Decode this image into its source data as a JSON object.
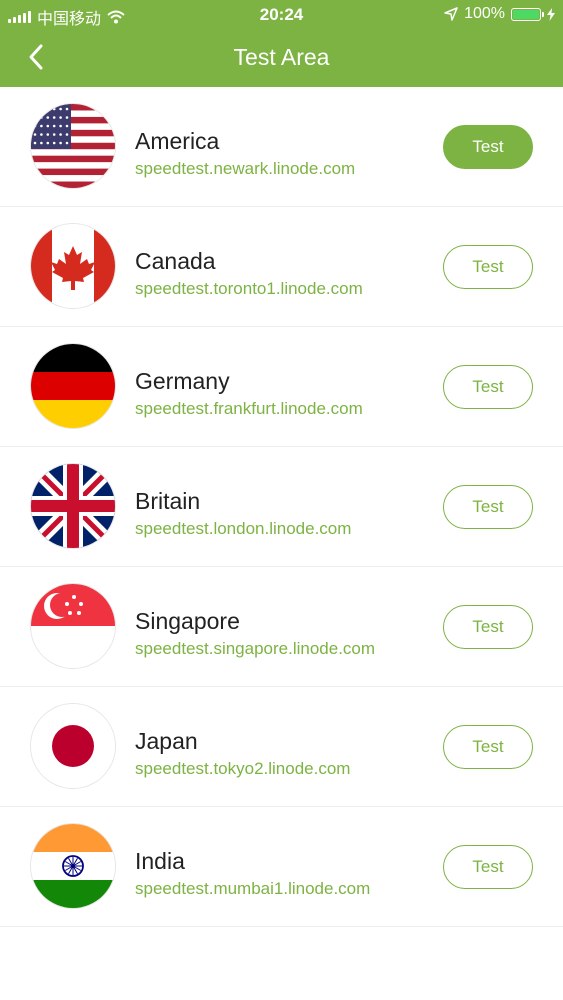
{
  "status_bar": {
    "carrier": "中国移动",
    "time": "20:24",
    "battery_percent": "100%",
    "battery_level": 1.0,
    "battery_color": "#4cd964"
  },
  "header": {
    "title": "Test Area",
    "back_icon": "chevron-left-icon",
    "background": "#7cb342"
  },
  "accent_color": "#7cb342",
  "servers": [
    {
      "country": "America",
      "host": "speedtest.newark.linode.com",
      "button": "Test",
      "selected": true,
      "flag": "us"
    },
    {
      "country": "Canada",
      "host": "speedtest.toronto1.linode.com",
      "button": "Test",
      "selected": false,
      "flag": "ca"
    },
    {
      "country": "Germany",
      "host": "speedtest.frankfurt.linode.com",
      "button": "Test",
      "selected": false,
      "flag": "de"
    },
    {
      "country": "Britain",
      "host": "speedtest.london.linode.com",
      "button": "Test",
      "selected": false,
      "flag": "gb"
    },
    {
      "country": "Singapore",
      "host": "speedtest.singapore.linode.com",
      "button": "Test",
      "selected": false,
      "flag": "sg"
    },
    {
      "country": "Japan",
      "host": "speedtest.tokyo2.linode.com",
      "button": "Test",
      "selected": false,
      "flag": "jp"
    },
    {
      "country": "India",
      "host": "speedtest.mumbai1.linode.com",
      "button": "Test",
      "selected": false,
      "flag": "in"
    }
  ]
}
